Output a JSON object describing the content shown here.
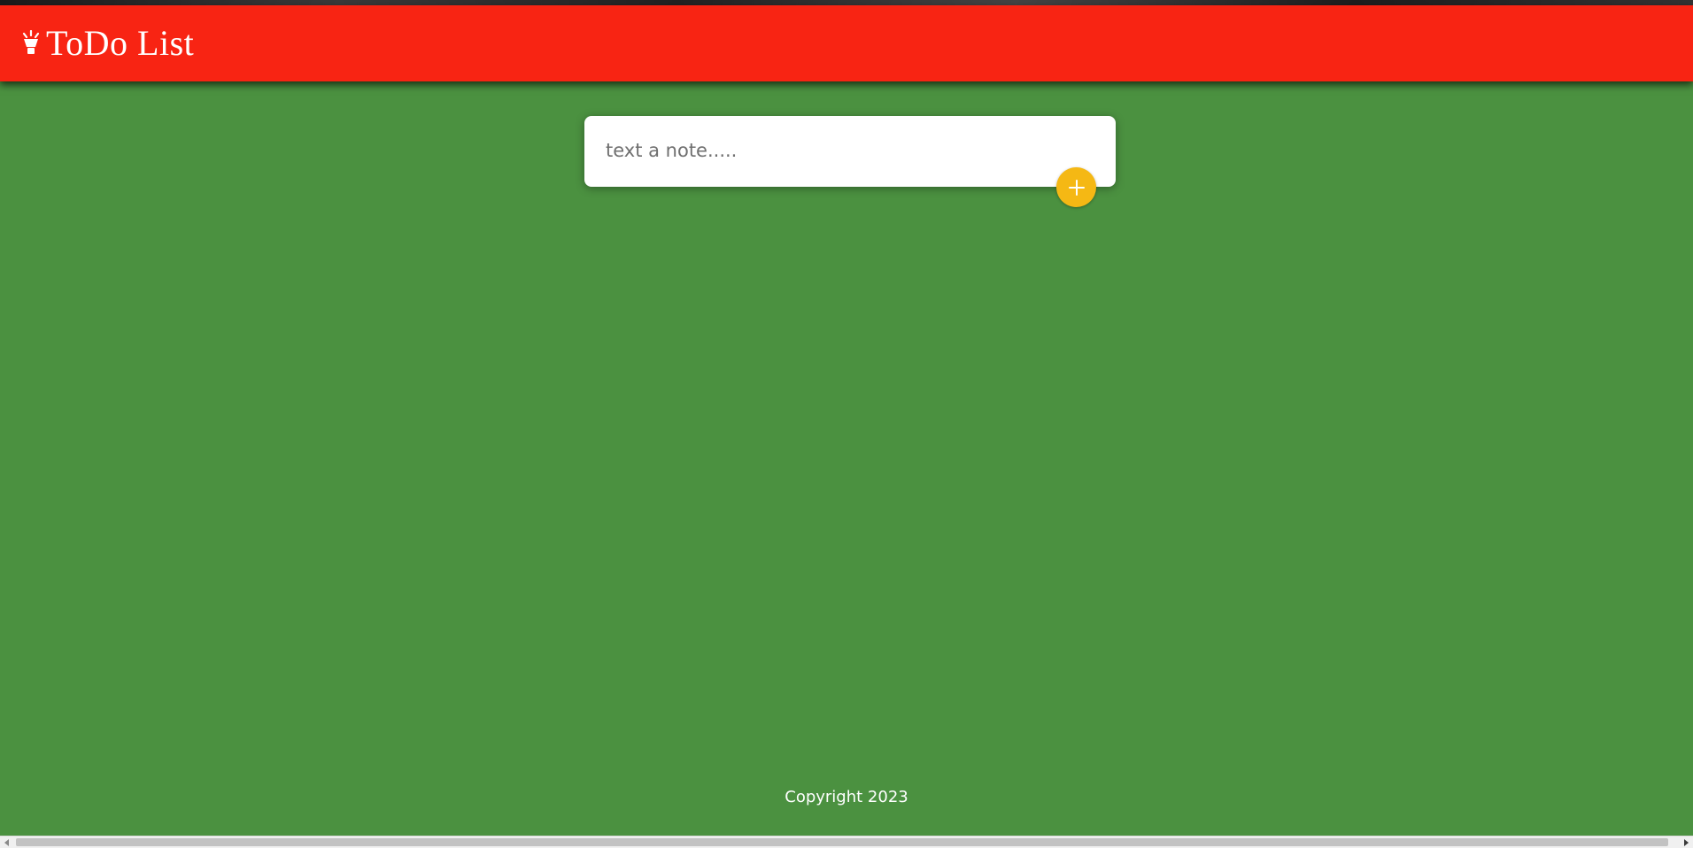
{
  "header": {
    "title": "ToDo List",
    "logo_icon": "lightbulb-icon",
    "background": "#f82413"
  },
  "note": {
    "placeholder": "text a note.....",
    "value": ""
  },
  "add_button": {
    "icon": "plus-icon",
    "color": "#f5b814"
  },
  "footer": {
    "copyright": "Copyright 2023"
  },
  "colors": {
    "page_background": "#4b9140",
    "text_light": "#ffffff"
  }
}
